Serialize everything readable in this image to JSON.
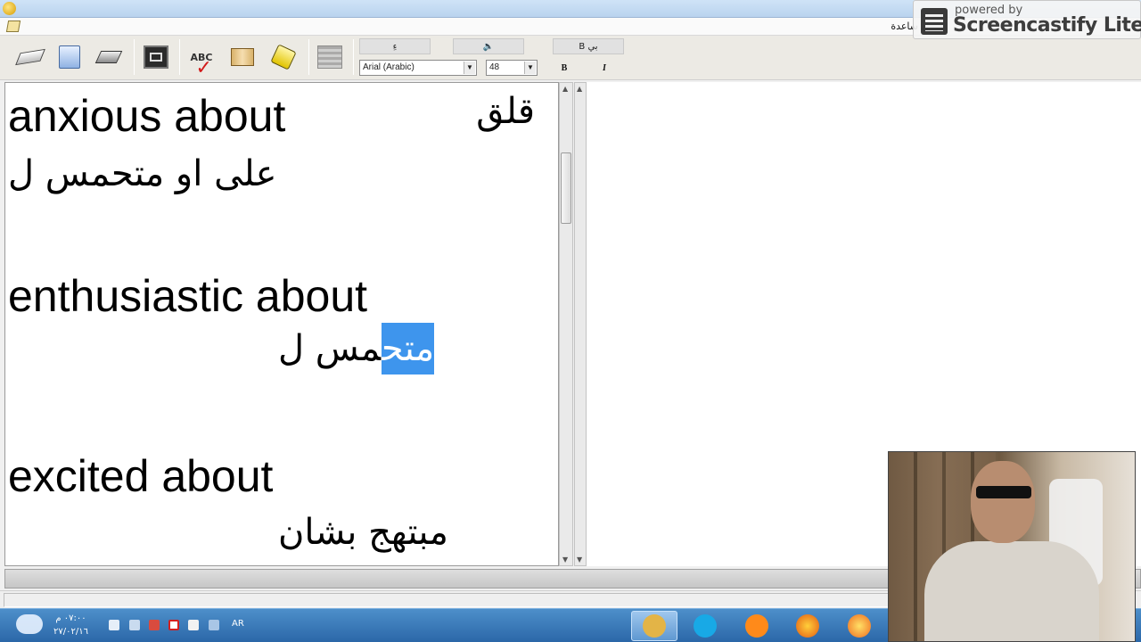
{
  "menu": {
    "item": "ساعدة"
  },
  "toolbar": {
    "buttons": [
      "eraser-icon",
      "folder-icon",
      "disk-icon",
      "screen-icon",
      "spellcheck-icon",
      "book-icon",
      "paint-icon",
      "calculator-icon"
    ],
    "spell_label": "ABC",
    "format_head_1": "ءِ",
    "format_head_2": "🔈",
    "format_head_3": "B بي",
    "font_name": "Arial (Arabic)",
    "font_size": "48",
    "bold_label": "B",
    "italic_label": "I"
  },
  "watermark": {
    "line1": "powered by",
    "line2": "Screencastify Lite"
  },
  "editor": {
    "lines": [
      {
        "en": "anxious about",
        "ar": "قلق"
      },
      {
        "ar": "على او متحمس ل"
      },
      {
        "en": "enthusiastic about"
      },
      {
        "ar_plain": "مس ل",
        "ar_selected": "متح"
      },
      {
        "en": "excited about"
      },
      {
        "ar": "مبتهج بشان"
      }
    ]
  },
  "taskbar": {
    "clock_time": "٠٧:٠٠ م",
    "clock_date": "٢٧/٠٢/١٦",
    "lang": "AR"
  },
  "colors": {
    "selection": "#3e95ed",
    "taskbar": "#2b67a8"
  }
}
